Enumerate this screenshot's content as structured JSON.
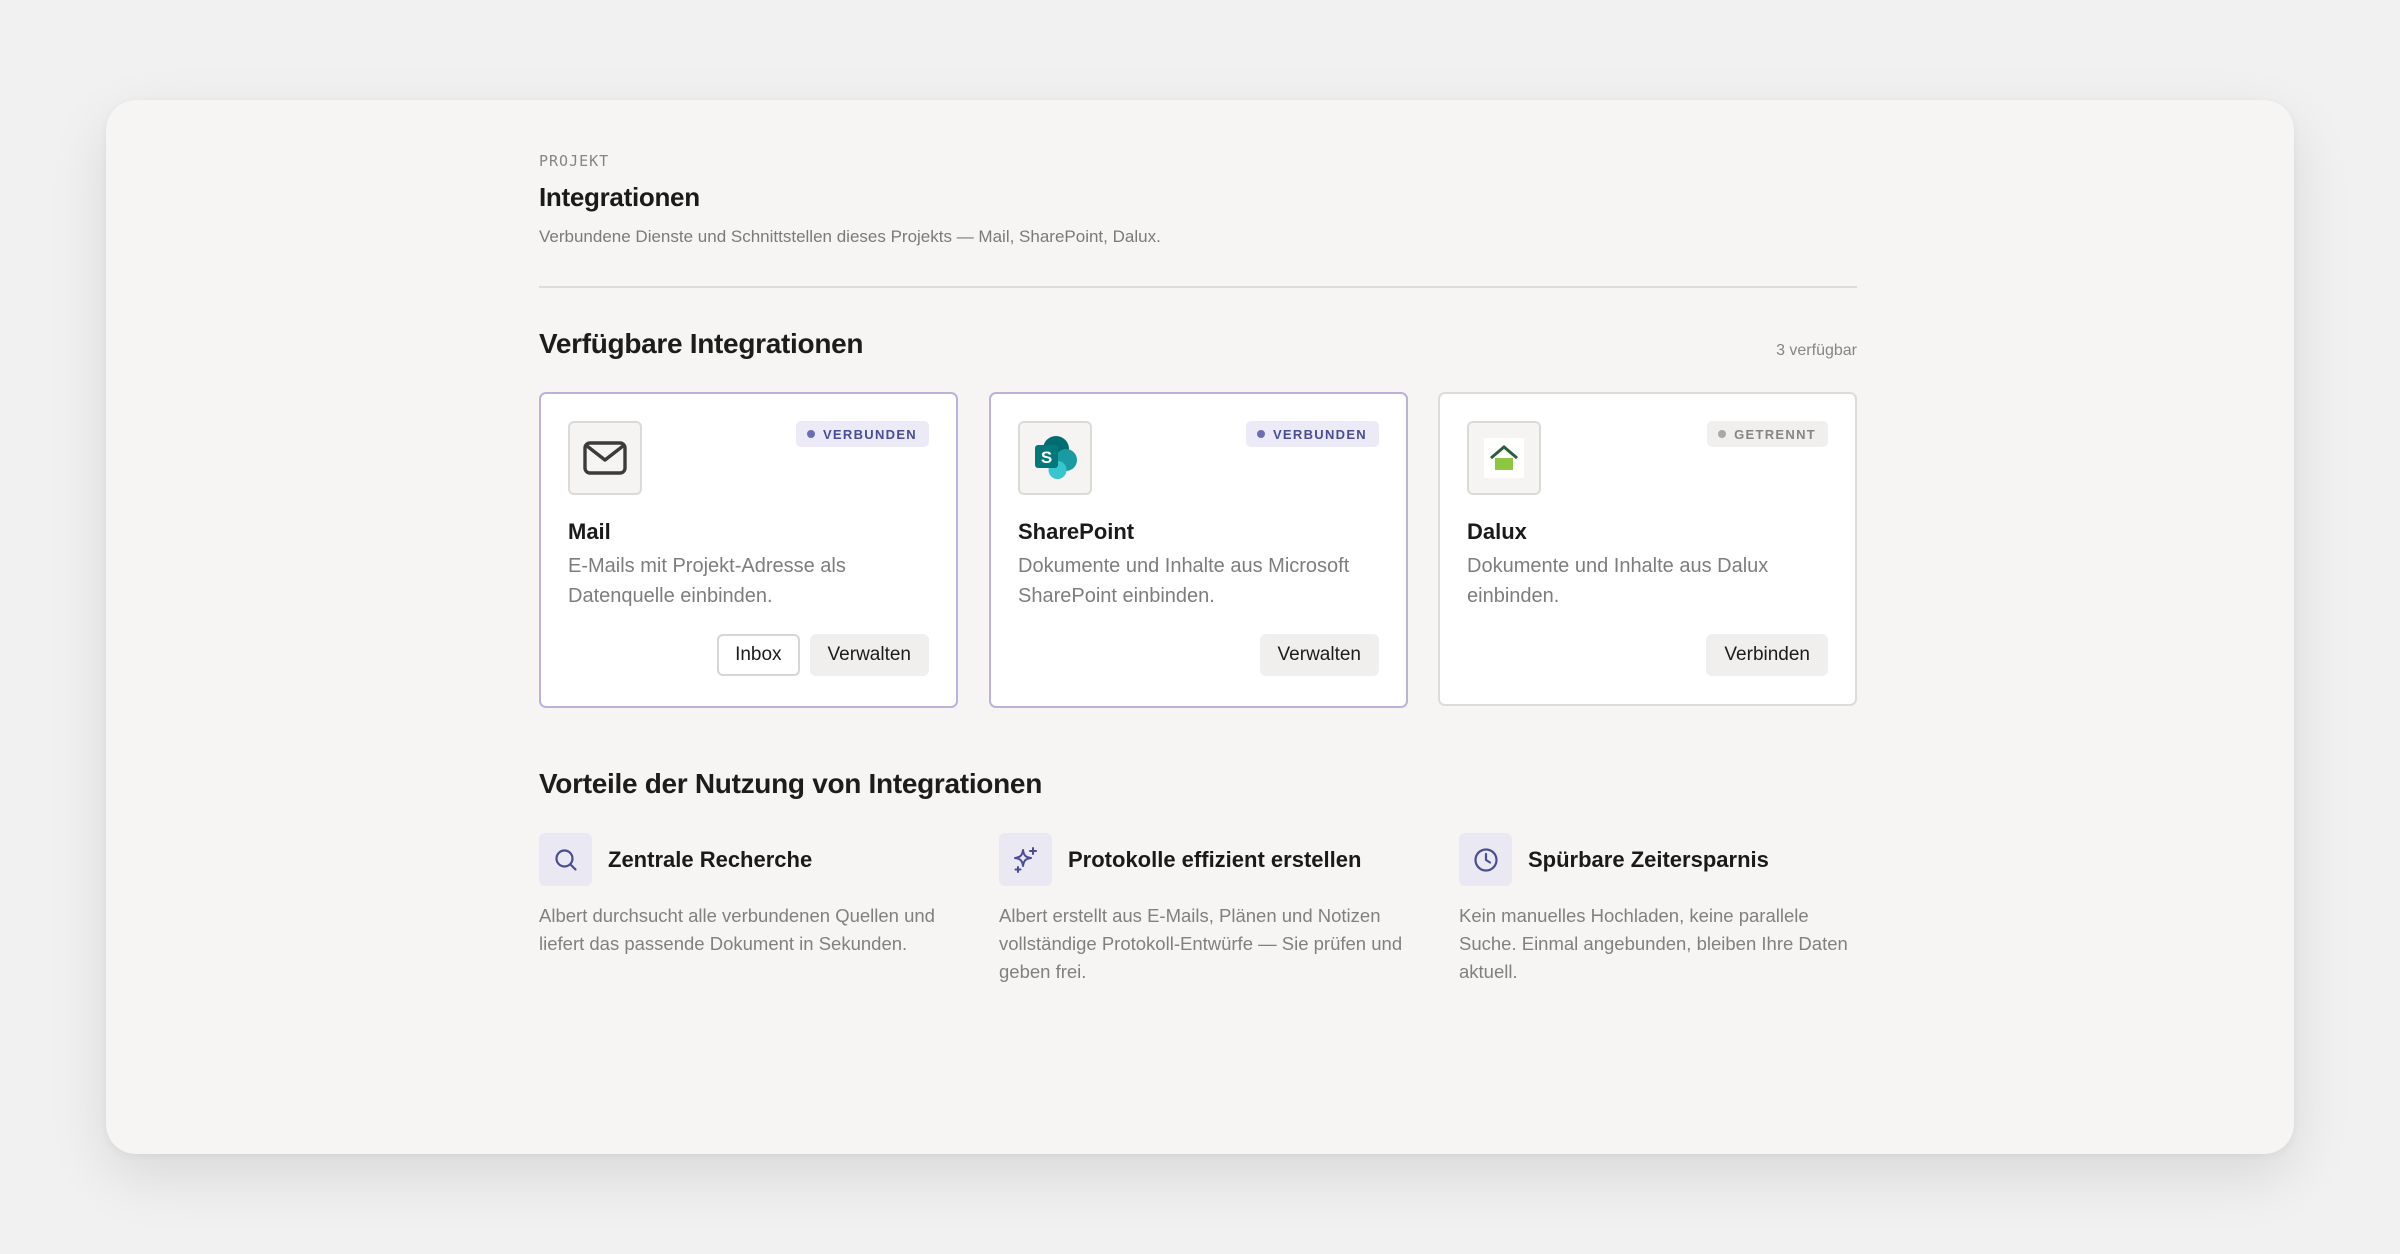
{
  "header": {
    "eyebrow": "PROJEKT",
    "title": "Integrationen",
    "subtitle": "Verbundene Dienste und Schnittstellen dieses Projekts — Mail, SharePoint, Dalux."
  },
  "available": {
    "heading": "Verfügbare Integrationen",
    "count": "3 verfügbar",
    "cards": [
      {
        "icon": "mail-icon",
        "status": "VERBUNDEN",
        "name": "Mail",
        "description": "E-Mails mit Projekt-Adresse als Datenquelle einbinden.",
        "actions": [
          "Inbox",
          "Verwalten"
        ]
      },
      {
        "icon": "sharepoint-logo",
        "status": "VERBUNDEN",
        "name": "SharePoint",
        "description": "Dokumente und Inhalte aus Microsoft SharePoint einbinden.",
        "actions": [
          "Verwalten"
        ]
      },
      {
        "icon": "dalux-logo",
        "status": "GETRENNT",
        "name": "Dalux",
        "description": "Dokumente und Inhalte aus Dalux einbinden.",
        "actions": [
          "Verbinden"
        ]
      }
    ]
  },
  "benefits": {
    "heading": "Vorteile der Nutzung von Integrationen",
    "items": [
      {
        "icon": "search-icon",
        "title": "Zentrale Recherche",
        "description": "Albert durchsucht alle verbundenen Quellen und liefert das passende Dokument in Sekunden."
      },
      {
        "icon": "sparkle-icon",
        "title": "Protokolle effizient erstellen",
        "description": "Albert erstellt aus E-Mails, Plänen und Notizen vollständige Protokoll-Entwürfe — Sie prüfen und geben frei."
      },
      {
        "icon": "clock-icon",
        "title": "Spürbare Zeitersparnis",
        "description": "Kein manuelles Hochladen, keine parallele Suche. Einmal angebunden, bleiben Ihre Daten aktuell."
      }
    ]
  },
  "colors": {
    "accent": "#4a4c95",
    "connected_border": "#b9b3dc",
    "sharepoint_teal": "#036c70",
    "dalux_green": "#8dc63f"
  }
}
